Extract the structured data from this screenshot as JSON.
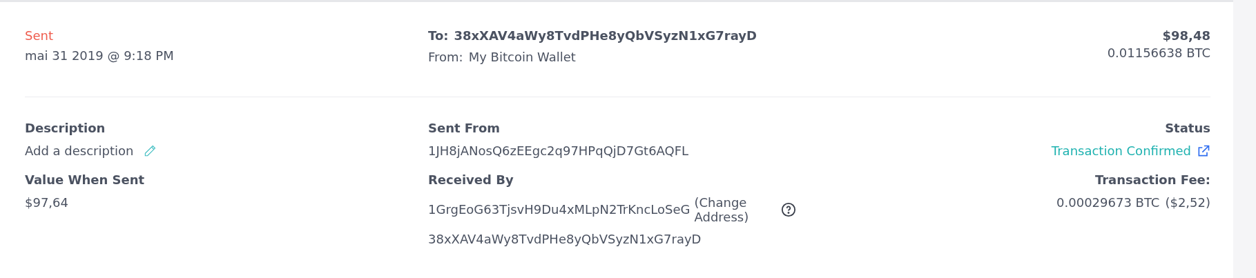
{
  "transaction": {
    "direction": "Sent",
    "date": "mai 31 2019 @ 9:18 PM",
    "to_label": "To:",
    "to_address": "38xXAV4aWy8TvdPHe8yQbVSyzN1xG7rayD",
    "from_label": "From:",
    "from_wallet": "My Bitcoin Wallet",
    "amount_fiat": "$98,48",
    "amount_btc": "0.01156638 BTC"
  },
  "details": {
    "description_label": "Description",
    "description_placeholder": "Add a description",
    "value_label": "Value When Sent",
    "value": "$97,64",
    "sent_from_label": "Sent From",
    "sent_from": "1JH8jANosQ6zEEgc2q97HPqQjD7Gt6AQFL",
    "received_by_label": "Received By",
    "received_by": [
      {
        "address": "1GrgEoG63TjsvH9Du4xMLpN2TrKncLoSeG",
        "note": "(Change Address)",
        "help": true
      },
      {
        "address": "38xXAV4aWy8TvdPHe8yQbVSyzN1xG7rayD",
        "help": false
      }
    ],
    "status_label": "Status",
    "status": "Transaction Confirmed",
    "fee_label": "Transaction Fee:",
    "fee_btc": "0.00029673 BTC",
    "fee_fiat": "($2,52)"
  }
}
